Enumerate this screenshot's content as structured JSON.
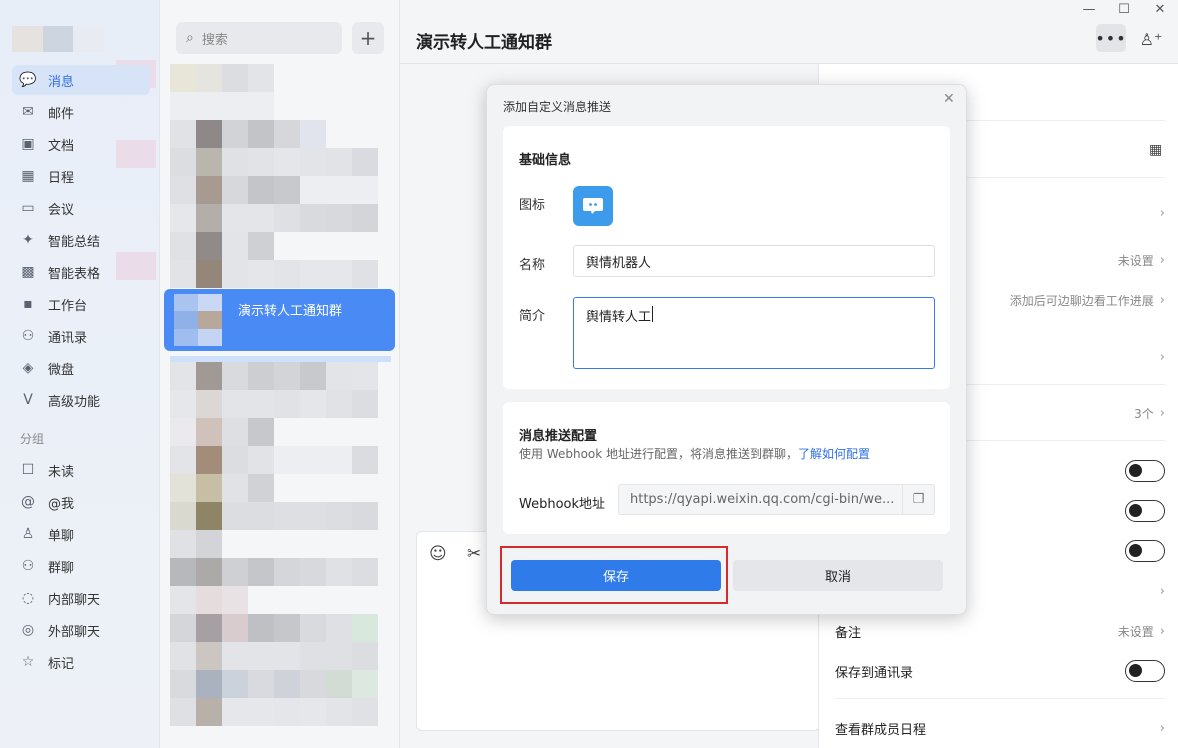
{
  "nav": {
    "items": [
      {
        "label": "消息",
        "icon": "message-icon",
        "glyph": "💬",
        "active": true
      },
      {
        "label": "邮件",
        "icon": "mail-icon",
        "glyph": "✉"
      },
      {
        "label": "文档",
        "icon": "document-icon",
        "glyph": "▣"
      },
      {
        "label": "日程",
        "icon": "calendar-icon",
        "glyph": "▦"
      },
      {
        "label": "会议",
        "icon": "meeting-icon",
        "glyph": "▭"
      },
      {
        "label": "智能总结",
        "icon": "sparkle-icon",
        "glyph": "✦"
      },
      {
        "label": "智能表格",
        "icon": "table-icon",
        "glyph": "▩"
      },
      {
        "label": "工作台",
        "icon": "workbench-icon",
        "glyph": "▪"
      },
      {
        "label": "通讯录",
        "icon": "contacts-icon",
        "glyph": "⚇"
      },
      {
        "label": "微盘",
        "icon": "drive-icon",
        "glyph": "◈"
      },
      {
        "label": "高级功能",
        "icon": "advanced-icon",
        "glyph": "V"
      }
    ],
    "section_label": "分组",
    "groups": [
      {
        "label": "未读",
        "icon": "unread-icon",
        "glyph": "☐"
      },
      {
        "label": "@我",
        "icon": "at-icon",
        "glyph": "@"
      },
      {
        "label": "单聊",
        "icon": "single-chat-icon",
        "glyph": "♙"
      },
      {
        "label": "群聊",
        "icon": "group-chat-icon",
        "glyph": "⚇"
      },
      {
        "label": "内部聊天",
        "icon": "internal-chat-icon",
        "glyph": "◌"
      },
      {
        "label": "外部聊天",
        "icon": "external-chat-icon",
        "glyph": "◎"
      },
      {
        "label": "标记",
        "icon": "star-icon",
        "glyph": "☆"
      }
    ]
  },
  "search": {
    "placeholder": "搜索"
  },
  "conversation": {
    "selected_name": "演示转人工通知群"
  },
  "chat": {
    "title": "演示转人工通知群"
  },
  "info_panel": {
    "rows": [
      {
        "label": "",
        "value": "未设置"
      },
      {
        "label": "",
        "value": "添加后可边聊边看工作进展"
      },
      {
        "label": "",
        "value": "3个"
      },
      {
        "label": "备注",
        "value": "未设置"
      },
      {
        "label": "保存到通讯录",
        "value": ""
      },
      {
        "label": "查看群成员日程",
        "value": ""
      }
    ]
  },
  "modal": {
    "title": "添加自定义消息推送",
    "basic_heading": "基础信息",
    "icon_label": "图标",
    "name_label": "名称",
    "name_value": "舆情机器人",
    "intro_label": "简介",
    "intro_value": "舆情转人工",
    "push_heading": "消息推送配置",
    "push_hint": "使用 Webhook 地址进行配置，将消息推送到群聊，",
    "push_link": "了解如何配置",
    "webhook_label": "Webhook地址",
    "webhook_value": "https://qyapi.weixin.qq.com/cgi-bin/we...",
    "save_label": "保存",
    "cancel_label": "取消"
  },
  "colors": {
    "accent": "#2f7bea",
    "highlight": "#d42c2c",
    "selected_conv": "#4a8af4"
  }
}
